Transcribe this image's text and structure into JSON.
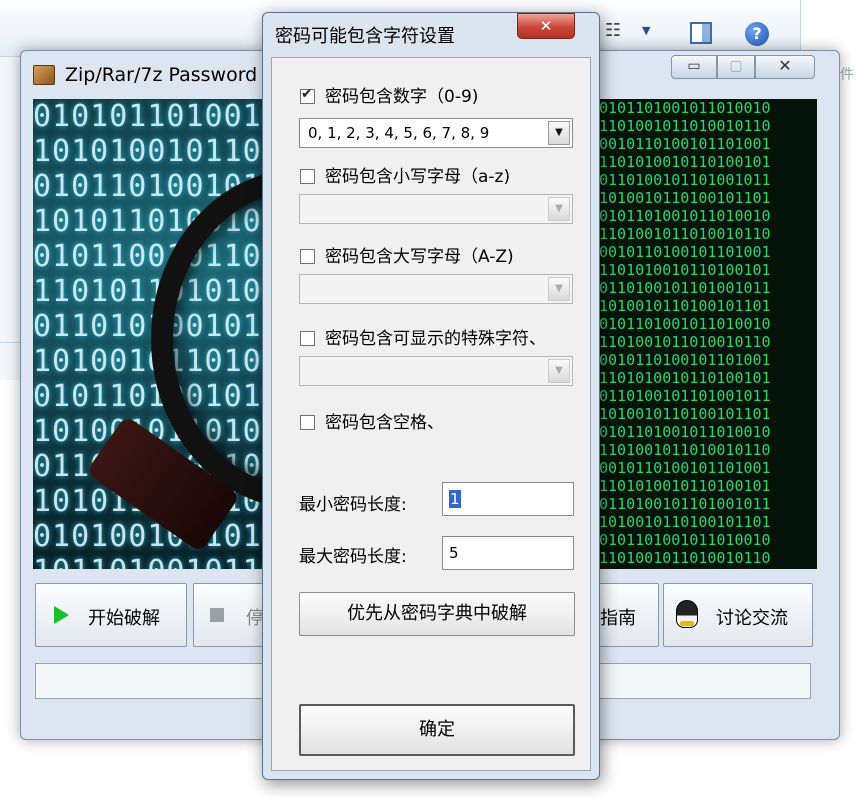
{
  "background": {
    "right_fragment": "件"
  },
  "main_window": {
    "title": "Zip/Rar/7z Password C",
    "min_glyph": "▭",
    "max_glyph": "▢",
    "close_glyph": "✕",
    "buttons": {
      "start": "开始破解",
      "stop": "停",
      "guide": "指南",
      "discuss": "讨论交流"
    }
  },
  "dialog": {
    "title": "密码可能包含字符设置",
    "close_glyph": "✕",
    "options": [
      {
        "label": "密码包含数字（0-9)",
        "checked": true
      },
      {
        "label": "密码包含小写字母（a-z)",
        "checked": false
      },
      {
        "label": "密码包含大写字母（A-Z)",
        "checked": false
      },
      {
        "label": "密码包含可显示的特殊字符、",
        "checked": false
      },
      {
        "label": "密码包含空格、",
        "checked": false
      }
    ],
    "digits_select": "0, 1, 2, 3, 4, 5, 6, 7, 8, 9",
    "min_length_label": "最小密码长度:",
    "min_length_value": "1",
    "max_length_label": "最大密码长度:",
    "max_length_value": "5",
    "dict_button": "优先从密码字典中破解",
    "ok_button": "确定"
  },
  "colors": {
    "play_icon": "#1cbf2a",
    "selection": "#3366cc",
    "close_button": "#c9463a",
    "binary_left": "#d8f6ff",
    "binary_right": "#29d46b"
  },
  "icons": [
    "box-app-icon",
    "play-icon",
    "stop-icon",
    "penguin-icon",
    "help-icon",
    "view-list-icon",
    "preview-pane-icon",
    "checkbox-icon",
    "dropdown-arrow-icon"
  ]
}
